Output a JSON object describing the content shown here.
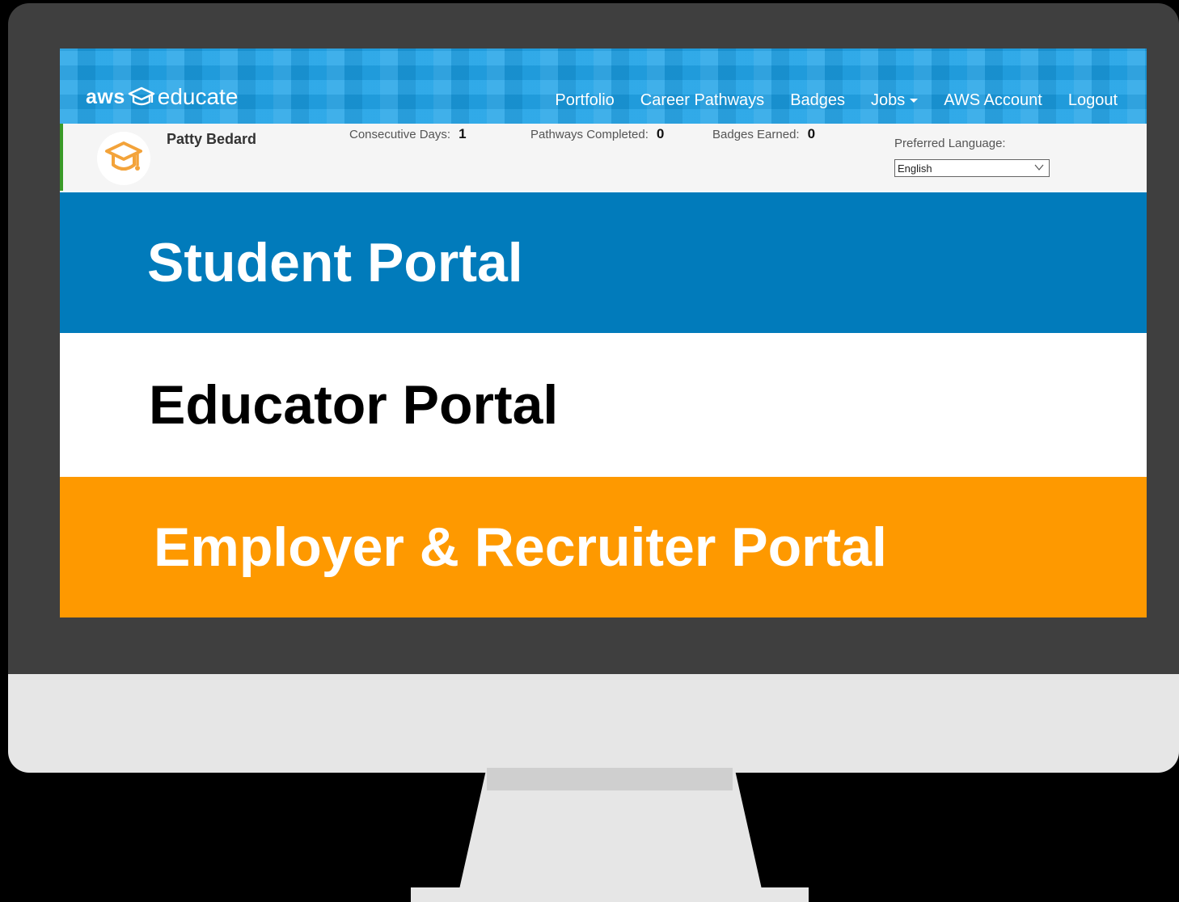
{
  "header": {
    "logo": {
      "aws": "aws",
      "educate": "educate",
      "icon": "graduation-cap-icon"
    },
    "nav": [
      "Portfolio",
      "Career Pathways",
      "Badges",
      "Jobs",
      "AWS Account",
      "Logout"
    ]
  },
  "user": {
    "name": "Patty Bedard",
    "avatar_icon": "graduation-cap-icon",
    "stats": {
      "consecutive_days": {
        "label": "Consecutive Days:",
        "value": "1"
      },
      "pathways_completed": {
        "label": "Pathways Completed:",
        "value": "0"
      },
      "badges_earned": {
        "label": "Badges Earned:",
        "value": "0"
      }
    },
    "language": {
      "label": "Preferred Language:",
      "selected": "English"
    }
  },
  "portals": {
    "student": "Student Portal",
    "educator": "Educator Portal",
    "employer": "Employer & Recruiter Portal"
  },
  "colors": {
    "nav_blue": "#1aa0e6",
    "student_blue": "#017bbb",
    "employer_orange": "#fe9900",
    "avatar_orange": "#f3a33a",
    "accent_green": "#3a9a28",
    "bezel": "#3f3f3f",
    "chin": "#e6e6e6"
  }
}
